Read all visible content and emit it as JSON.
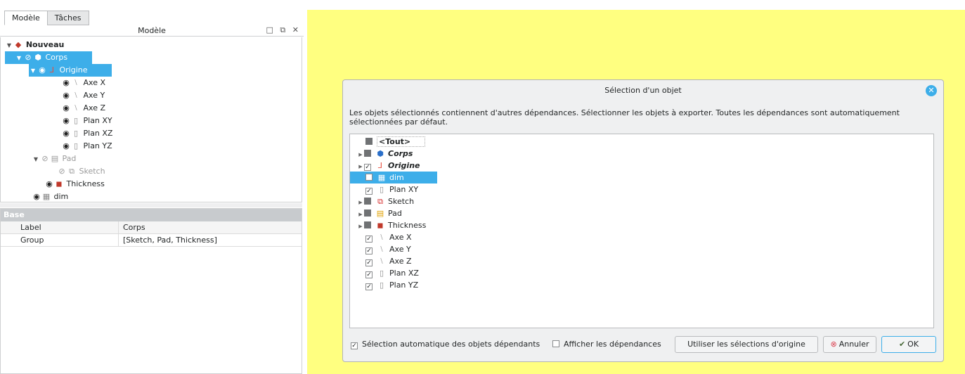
{
  "tabs": [
    "Modèle",
    "Tâches"
  ],
  "tree_header": {
    "title": "Modèle",
    "buttons": "□ ⧉ ✕"
  },
  "tree": {
    "root": "Nouveau",
    "corps": "Corps",
    "origine": "Origine",
    "axe_x": "Axe X",
    "axe_y": "Axe Y",
    "axe_z": "Axe Z",
    "plan_xy": "Plan XY",
    "plan_xz": "Plan XZ",
    "plan_yz": "Plan YZ",
    "pad": "Pad",
    "sketch": "Sketch",
    "thickness": "Thickness",
    "dim": "dim"
  },
  "properties": {
    "group": "Base",
    "rows": [
      {
        "name": "Label",
        "value": "Corps"
      },
      {
        "name": "Group",
        "value": "[Sketch, Pad, Thickness]"
      }
    ]
  },
  "dialog": {
    "title": "Sélection d'un objet",
    "message": "Les objets sélectionnés contiennent d'autres dépendances. Sélectionner les objets à exporter. Toutes les dépendances sont automatiquement sélectionnées par défaut.",
    "list": {
      "tout": "<Tout>",
      "corps": "Corps",
      "origine": "Origine",
      "dim": "dim",
      "plan_xy": "Plan XY",
      "sketch": "Sketch",
      "pad": "Pad",
      "thickness": "Thickness",
      "axe_x": "Axe X",
      "axe_y": "Axe Y",
      "axe_z": "Axe Z",
      "plan_xz": "Plan XZ",
      "plan_yz": "Plan YZ"
    },
    "footer": {
      "auto_select": "Sélection automatique des objets dépendants",
      "show_deps": "Afficher les dépendances",
      "use_original": "Utiliser les sélections d'origine",
      "cancel": "Annuler",
      "ok": "OK"
    }
  },
  "colors": {
    "accent": "#3daee9",
    "view_background": "#ffff80"
  }
}
